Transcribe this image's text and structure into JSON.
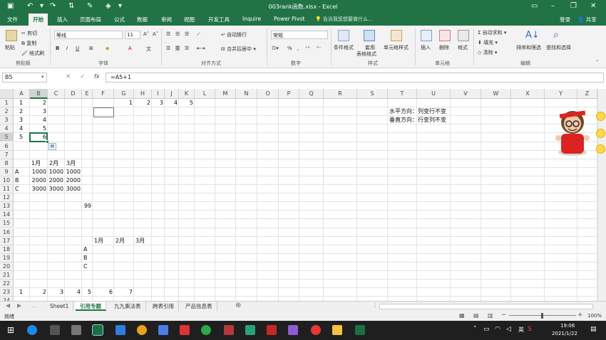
{
  "window": {
    "title": "003rank函数.xlsx - Excel",
    "signin": "登录",
    "share": "共享"
  },
  "menu": {
    "tabs": [
      "文件",
      "开始",
      "插入",
      "页面布局",
      "公式",
      "数据",
      "审阅",
      "视图",
      "开发工具",
      "Inquire",
      "Power Pivot"
    ],
    "active": "开始",
    "tell_me": "告诉我您想要做什么..."
  },
  "ribbon": {
    "clipboard": {
      "paste": "粘贴",
      "cut": "剪切",
      "copy": "复制",
      "format_painter": "格式刷",
      "group": "剪贴板"
    },
    "font": {
      "name": "等线",
      "size": "11",
      "bold": "B",
      "italic": "I",
      "underline": "U",
      "color_a": "A",
      "wen": "文",
      "group": "字体"
    },
    "alignment": {
      "wrap": "自动换行",
      "merge": "合并后居中",
      "group": "对齐方式"
    },
    "number": {
      "format": "常规",
      "percent": "%",
      "comma": ",",
      "group": "数字"
    },
    "styles": {
      "cond": "条件格式",
      "table1": "套用",
      "table2": "表格格式",
      "cell_styles": "单元格样式",
      "group": "样式"
    },
    "cells": {
      "insert": "插入",
      "delete": "删除",
      "format": "格式",
      "group": "单元格"
    },
    "editing": {
      "autosum": "自动求和",
      "fill": "填充",
      "clear": "清除",
      "sort": "排序和筛选",
      "find": "查找和选择",
      "group": "编辑"
    }
  },
  "formula_bar": {
    "name_box": "B5",
    "formula": "=A5+1"
  },
  "columns": [
    "A",
    "B",
    "C",
    "D",
    "E",
    "F",
    "G",
    "H",
    "I",
    "J",
    "K",
    "L",
    "M",
    "N",
    "O",
    "P",
    "Q",
    "R",
    "S",
    "T",
    "U",
    "V",
    "W",
    "X",
    "Y",
    "Z"
  ],
  "rows": [
    "1",
    "2",
    "3",
    "4",
    "5",
    "6",
    "7",
    "8",
    "9",
    "10",
    "11",
    "12",
    "13",
    "14",
    "15",
    "16",
    "17",
    "18",
    "19",
    "20",
    "21",
    "22",
    "23",
    "24"
  ],
  "cells": {
    "A1": "1",
    "B1": "2",
    "G1": "1",
    "H1": "2",
    "I1": "3",
    "J1": "4",
    "K1": "5",
    "A2": "2",
    "B2": "3",
    "T2": "水平方向：列变行不变",
    "A3": "3",
    "B3": "4",
    "T3": "垂直方向：行变列不变",
    "A4": "4",
    "B4": "5",
    "A5": "5",
    "B5": "6",
    "B8": "1月",
    "C8": "2月",
    "D8": "3月",
    "A9": "A",
    "B9": "1000",
    "C9": "1000",
    "D9": "1000",
    "A10": "B",
    "B10": "2000",
    "C10": "2000",
    "D10": "2000",
    "A11": "C",
    "B11": "3000",
    "C11": "3000",
    "D11": "3000",
    "E13": "99",
    "F17": "1月",
    "G17": "2月",
    "H17": "3月",
    "E18": "A",
    "E19": "B",
    "E20": "C",
    "A23": "1",
    "B23": "2",
    "C23": "3",
    "D23": "4",
    "E23": "5",
    "F23": "6",
    "G23": "7"
  },
  "sheet_tabs": [
    "Sheet1",
    "引用专题",
    "九九乘法表",
    "跨表引用",
    "产品信息表"
  ],
  "active_sheet": "引用专题",
  "status": {
    "ready": "就绪",
    "zoom": "100%"
  },
  "taskbar": {
    "time": "19:06",
    "date": "2021/1/22",
    "lang": "英"
  }
}
